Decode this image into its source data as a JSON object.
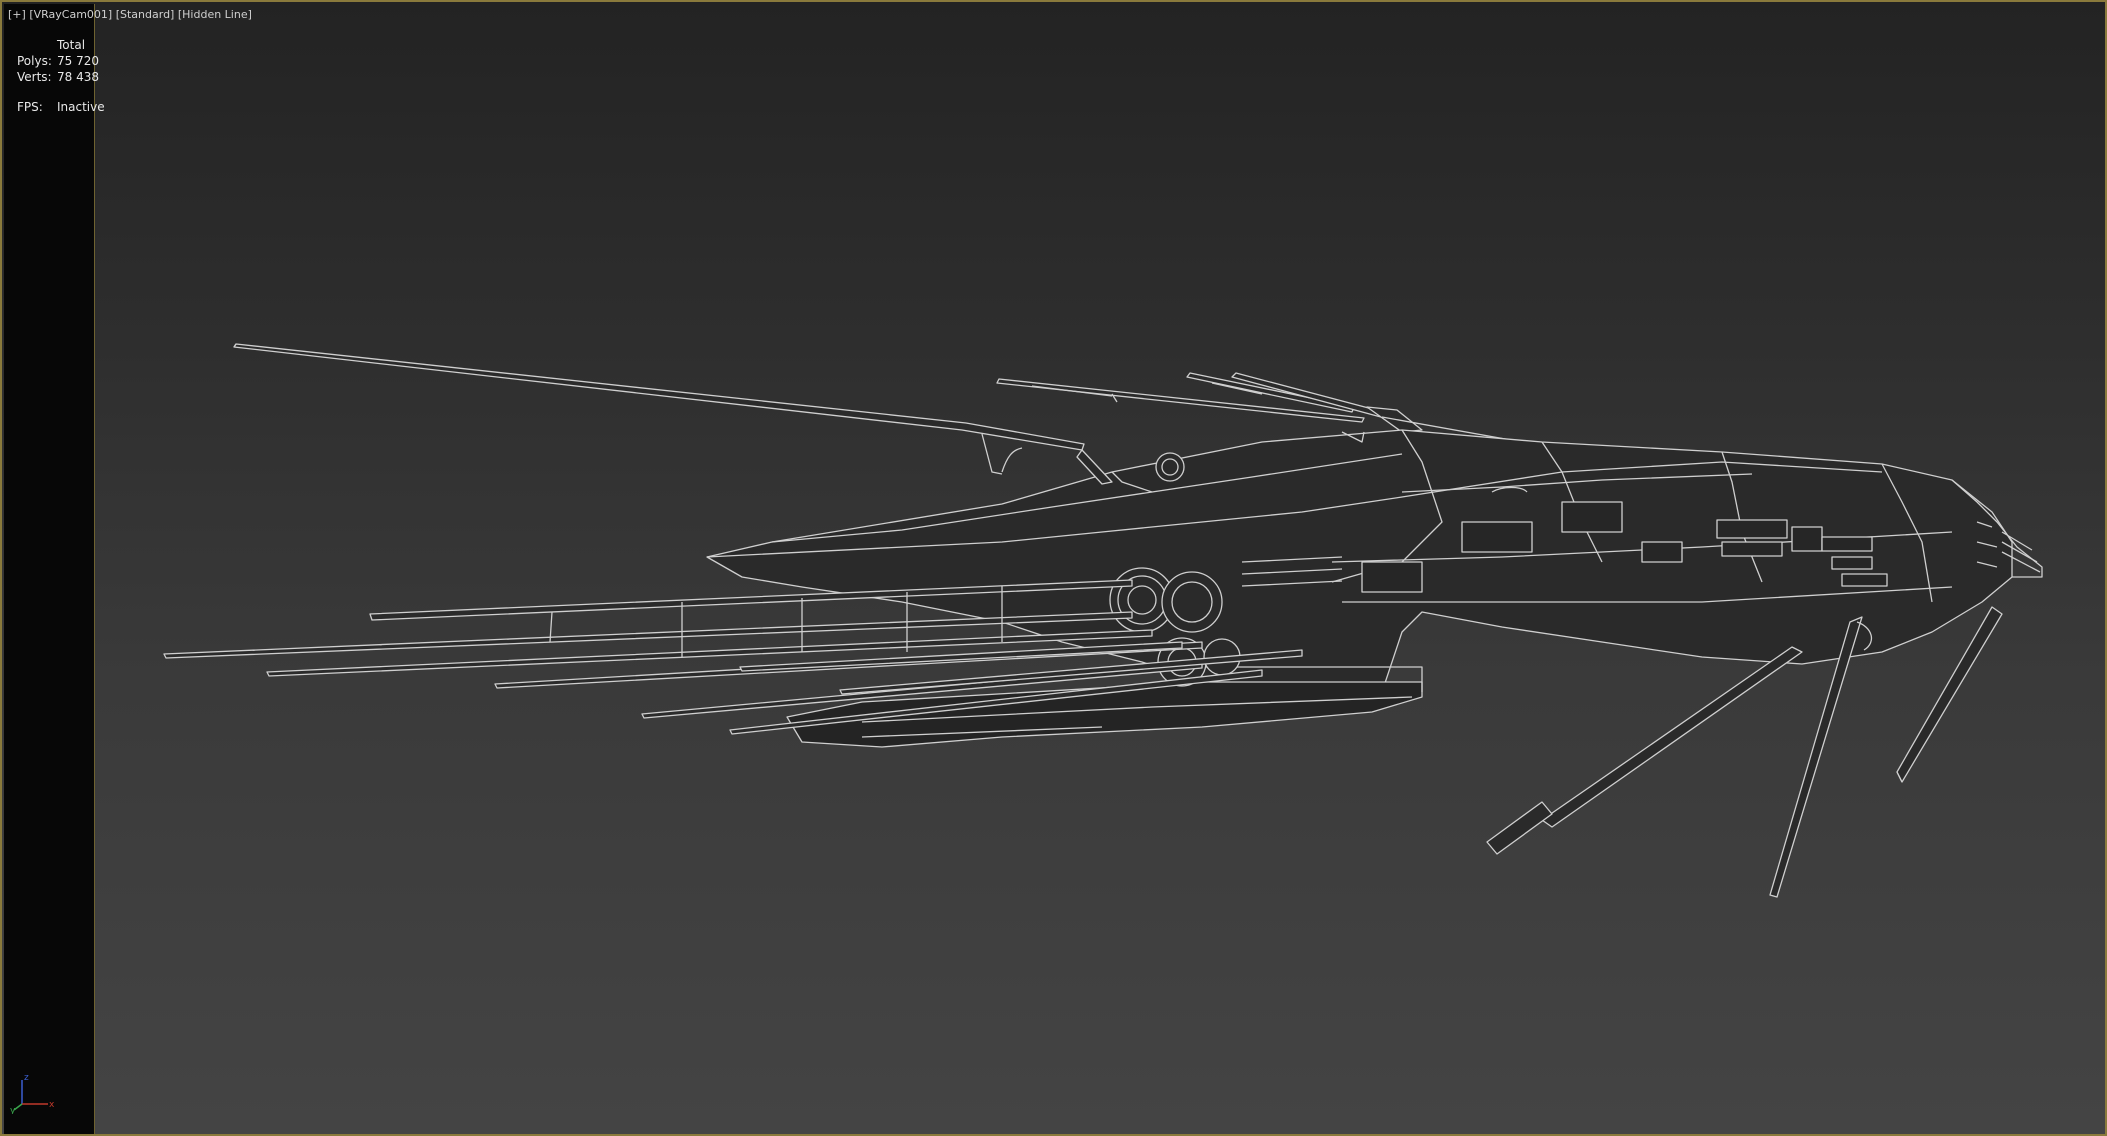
{
  "viewport": {
    "label_plus": "[+]",
    "label_camera": "[VRayCam001]",
    "label_shading": "[Standard]",
    "label_mode": "[Hidden Line]"
  },
  "stats": {
    "header": "Total",
    "polys_label": "Polys:",
    "polys_value": "75 720",
    "verts_label": "Verts:",
    "verts_value": "78 438",
    "fps_label": "FPS:",
    "fps_value": "Inactive"
  },
  "axis_gizmo": {
    "z_label": "z",
    "y_label": "y",
    "x_label": "x",
    "x_color": "#c0392b",
    "y_color": "#3aa64c",
    "z_color": "#3b5fd0"
  },
  "colors": {
    "frame": "#8a7a3c",
    "wire": "#d0d0d0",
    "fill": "#2a2a2a"
  },
  "scene": {
    "object": "spaceship-wireframe"
  }
}
